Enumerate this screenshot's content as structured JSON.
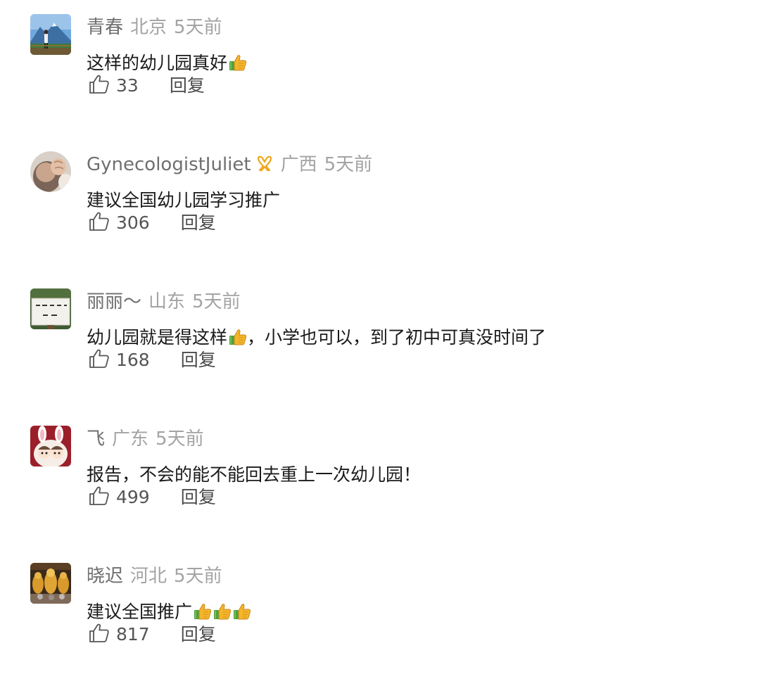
{
  "comments": [
    {
      "username": "青春",
      "location": "北京",
      "time": "5天前",
      "text": "这样的幼儿园真好",
      "emojis_after_text": 1,
      "likes": "33",
      "reply_label": "回复",
      "avatar": "mountain-landscape-avatar"
    },
    {
      "username": "GynecologistJuliet",
      "badge_icon": "gold-ribbon-badge-icon",
      "location": "广西",
      "time": "5天前",
      "text": "建议全国幼儿园学习推广",
      "likes": "306",
      "reply_label": "回复",
      "avatar": "fist-avatar"
    },
    {
      "username": "丽丽～",
      "location": "山东",
      "time": "5天前",
      "text_before_emoji": "幼儿园就是得这样",
      "text_after_emoji": "，小学也可以，到了初中可真没时间了",
      "likes": "168",
      "reply_label": "回复",
      "avatar": "sign-board-avatar"
    },
    {
      "username": "飞",
      "location": "广东",
      "time": "5天前",
      "text": "报告，不会的能不能回去重上一次幼儿园！",
      "likes": "499",
      "reply_label": "回复",
      "avatar": "cartoon-girls-avatar"
    },
    {
      "username": "晓迟",
      "location": "河北",
      "time": "5天前",
      "text": "建议全国推广",
      "emojis_after_text": 3,
      "likes": "817",
      "reply_label": "回复",
      "avatar": "golden-buddhas-avatar"
    }
  ],
  "colors": {
    "username": "#6f6f6f",
    "meta_gray": "#a3a3a3",
    "text": "#1a1a1a",
    "action": "#444444",
    "thumb_gold": "#f4b52a",
    "thumb_cuff_green": "#4fa03e"
  }
}
